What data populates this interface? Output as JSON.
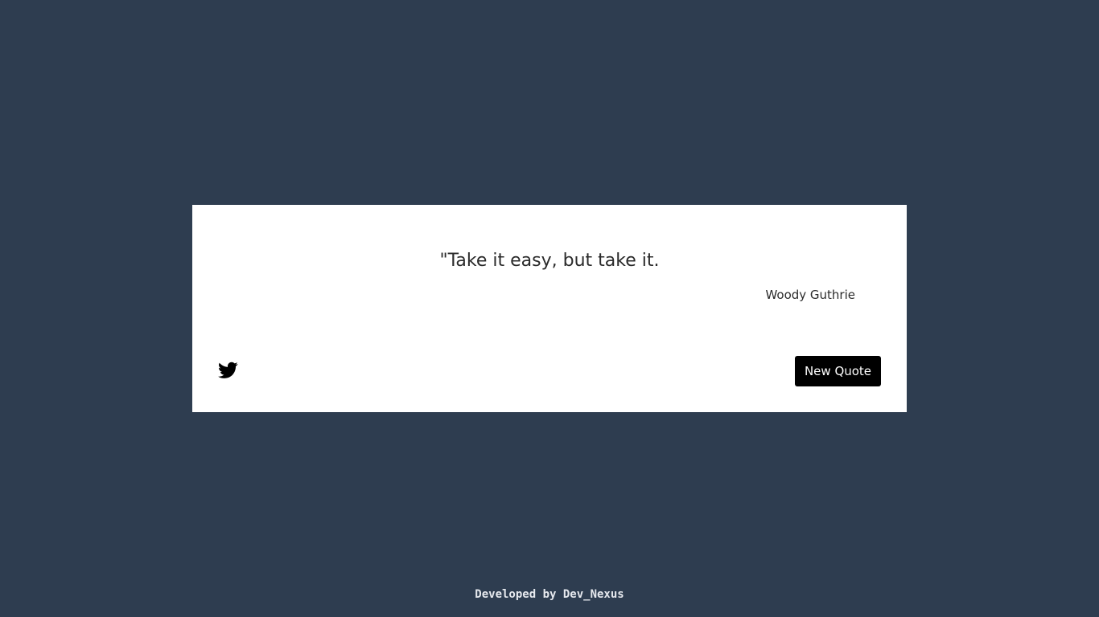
{
  "colors": {
    "background": "#2e3d50",
    "card": "#ffffff",
    "button_bg": "#000000",
    "button_text": "#ffffff",
    "text": "#2b2b2b",
    "footer_text": "#e6e9ee"
  },
  "quote": {
    "text": "\"Take it easy, but take it.",
    "author": "Woody Guthrie"
  },
  "actions": {
    "tweet_icon": "twitter-icon",
    "new_quote_label": "New Quote"
  },
  "footer": {
    "text": "Developed by Dev_Nexus"
  }
}
